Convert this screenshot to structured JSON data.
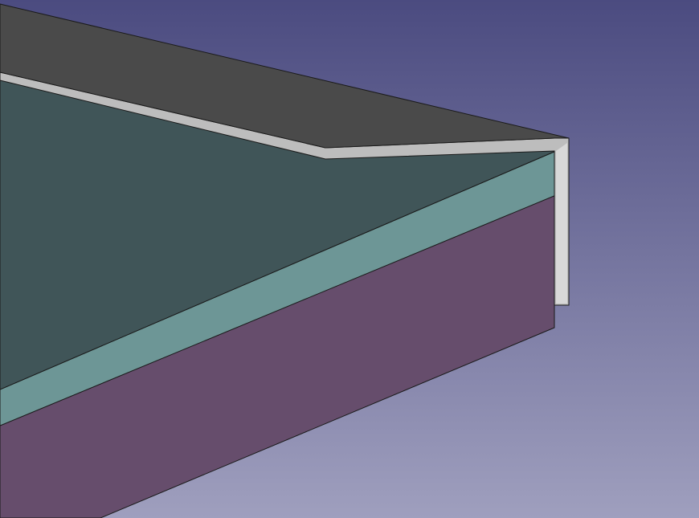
{
  "viewport": {
    "background_top": "#4b4b80",
    "background_bottom": "#9f9fbe"
  },
  "model": {
    "colors": {
      "lid_top": "#4a4a4a",
      "lid_edge": "#bdbdbd",
      "lid_edge_inner": "#d8d8d8",
      "panel_top": "#405558",
      "panel_band": "#6d9696",
      "base_side": "#664d6c"
    }
  }
}
